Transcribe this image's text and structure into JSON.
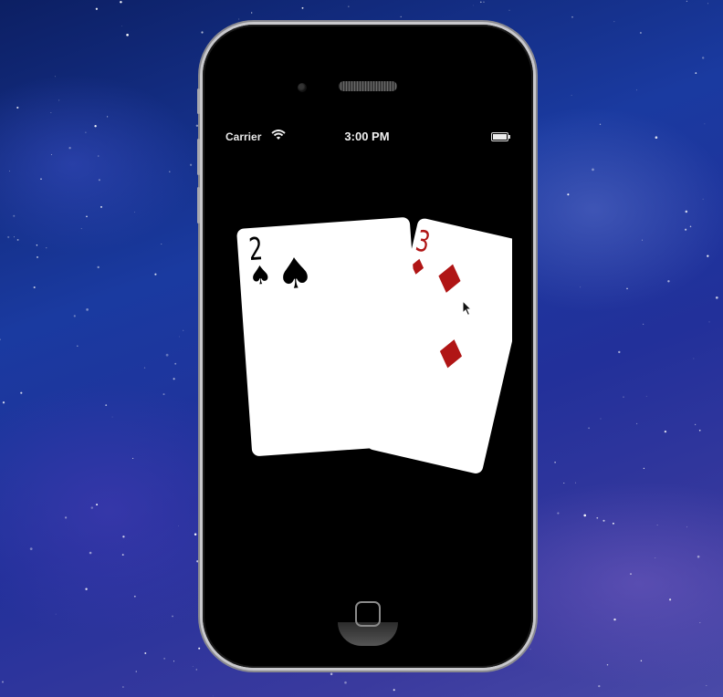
{
  "status_bar": {
    "carrier": "Carrier",
    "time": "3:00 PM",
    "wifi_icon": "wifi-icon",
    "battery_icon": "battery-icon"
  },
  "cards": [
    {
      "rank": "2",
      "suit": "spades",
      "suit_glyph": "♠",
      "color": "#000000"
    },
    {
      "rank": "3",
      "suit": "diamonds",
      "suit_glyph": "♦",
      "color": "#b01515"
    }
  ],
  "colors": {
    "screen_background": "#000000",
    "card_background": "#ffffff",
    "wallpaper_accent": "#1a3aa0"
  }
}
